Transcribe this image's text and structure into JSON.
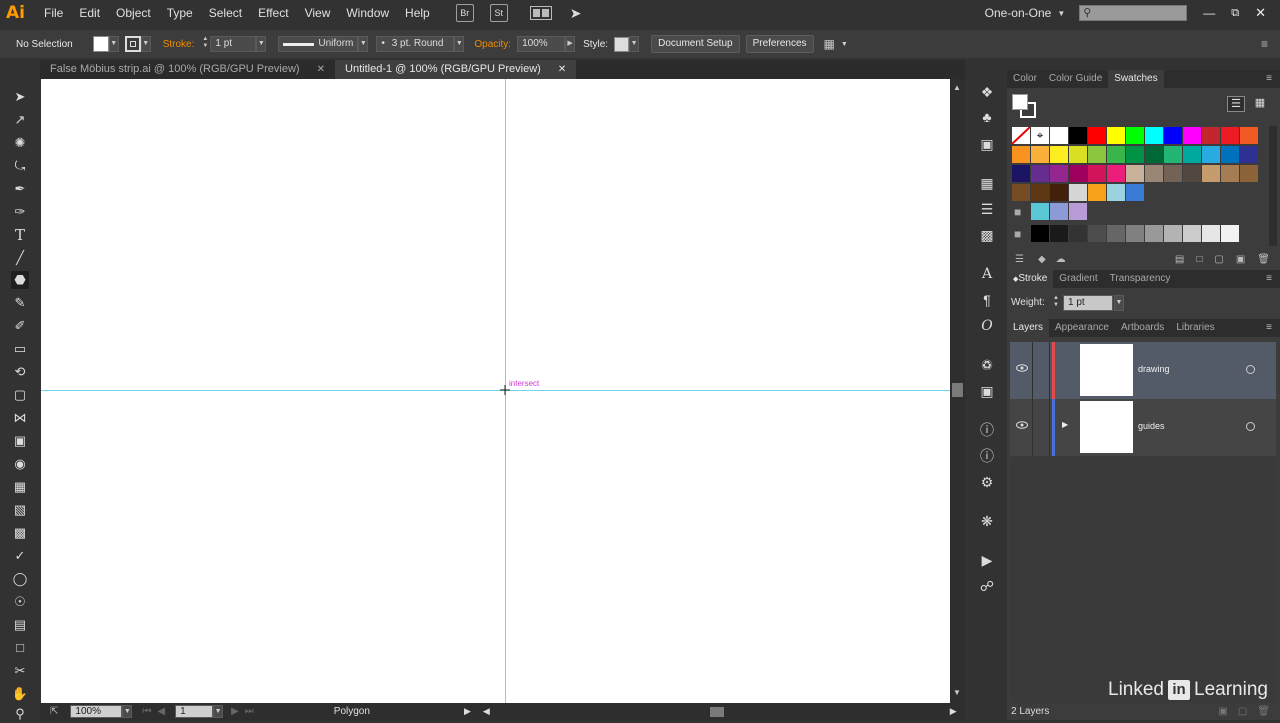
{
  "app": {
    "logo": "Ai",
    "workspace": "One-on-One"
  },
  "menu": [
    "File",
    "Edit",
    "Object",
    "Type",
    "Select",
    "Effect",
    "View",
    "Window",
    "Help"
  ],
  "menu_icons": {
    "bridge": "Br",
    "stock": "St"
  },
  "control": {
    "selection": "No Selection",
    "stroke_label": "Stroke:",
    "stroke_weight": "1 pt",
    "profile": "Uniform",
    "brush": "3 pt. Round",
    "opacity_label": "Opacity:",
    "opacity": "100%",
    "style_label": "Style:",
    "document_setup": "Document Setup",
    "preferences": "Preferences"
  },
  "tabs": [
    {
      "label": "False Möbius strip.ai @ 100% (RGB/GPU Preview)",
      "active": false
    },
    {
      "label": "Untitled-1 @ 100% (RGB/GPU Preview)",
      "active": true
    }
  ],
  "canvas": {
    "smart_guide": "intersect"
  },
  "status": {
    "zoom": "100%",
    "artboard": "1",
    "tool": "Polygon"
  },
  "panels": {
    "top_tabs": [
      "Color",
      "Color Guide",
      "Swatches"
    ],
    "active_top": "Swatches",
    "mid_tabs": [
      "Stroke",
      "Gradient",
      "Transparency"
    ],
    "weight_label": "Weight:",
    "weight": "1 pt",
    "layer_tabs": [
      "Layers",
      "Appearance",
      "Artboards",
      "Libraries"
    ],
    "layers": [
      {
        "name": "drawing",
        "color": "#e04a4a",
        "selected": true,
        "expandable": false
      },
      {
        "name": "guides",
        "color": "#4a6fd6",
        "selected": false,
        "expandable": true
      }
    ],
    "layer_count": "2 Layers"
  },
  "swatches": {
    "row1": [
      "#ffffff",
      "#000000",
      "#ff0000",
      "#ffff00",
      "#00ff00",
      "#00ffff",
      "#0000ff",
      "#ff00ff",
      "#c1272d",
      "#ed1c24",
      "#f15a24"
    ],
    "row2": [
      "#f7931e",
      "#fbb03b",
      "#fcee21",
      "#d9e021",
      "#8cc63f",
      "#39b54a",
      "#009245",
      "#006837",
      "#22b573",
      "#00a99d",
      "#29abe2",
      "#0071bc",
      "#2e3192"
    ],
    "row3": [
      "#1b1464",
      "#662d91",
      "#93278f",
      "#9e005d",
      "#d4145a",
      "#ed1e79",
      "#c7b299",
      "#998675",
      "#736357",
      "#534741",
      "#c69c6d",
      "#a67c52",
      "#8c6239"
    ],
    "row4": [
      "#754c24",
      "#603813",
      "#42210b"
    ],
    "group1": [
      "#5bc8d6",
      "#8c9bd6",
      "#b79bd6"
    ],
    "grays": [
      "#000000",
      "#1a1a1a",
      "#333333",
      "#4d4d4d",
      "#666666",
      "#808080",
      "#999999",
      "#b3b3b3",
      "#cccccc",
      "#e6e6e6",
      "#f2f2f2"
    ]
  },
  "watermark": {
    "brand": "Linked",
    "in": "in",
    "learning": "Learning"
  }
}
